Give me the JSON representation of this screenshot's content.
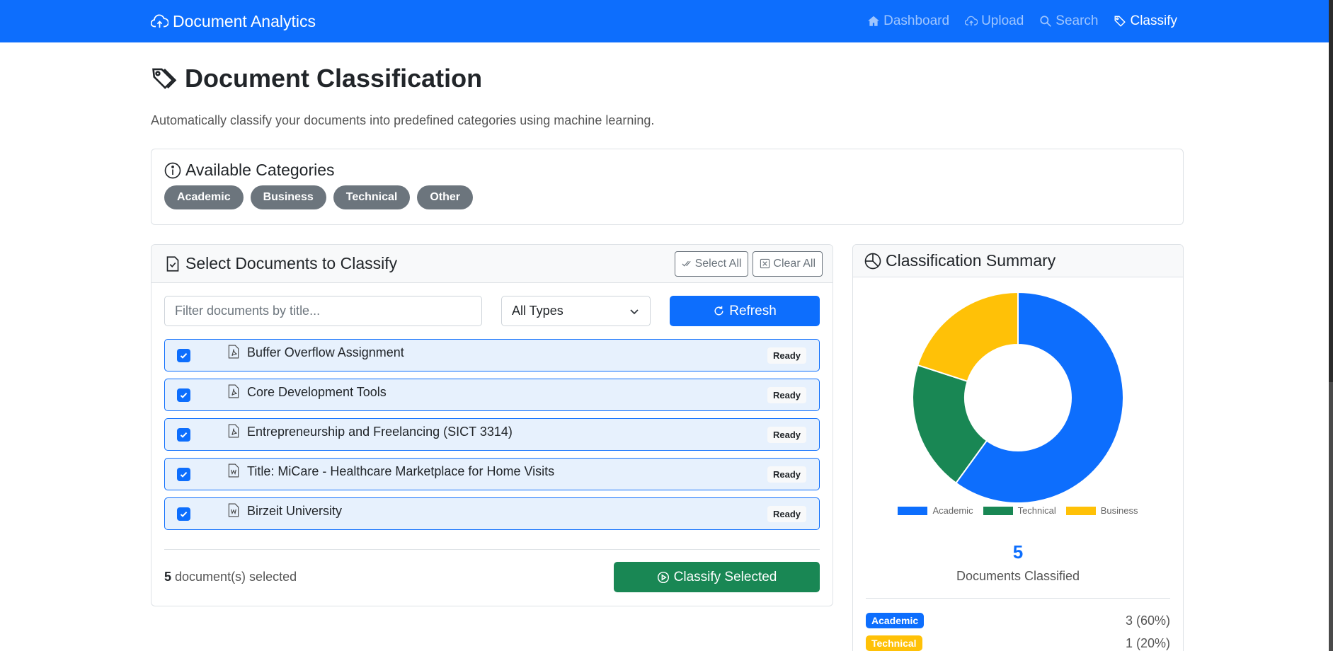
{
  "nav": {
    "brand": "Document Analytics",
    "links": [
      {
        "label": "Dashboard",
        "icon": "house-icon"
      },
      {
        "label": "Upload",
        "icon": "cloud-upload-icon"
      },
      {
        "label": "Search",
        "icon": "search-icon"
      },
      {
        "label": "Classify",
        "icon": "tags-icon",
        "active": true
      }
    ]
  },
  "page": {
    "title": "Document Classification",
    "lead": "Automatically classify your documents into predefined categories using machine learning."
  },
  "categories": {
    "title": "Available Categories",
    "items": [
      "Academic",
      "Business",
      "Technical",
      "Other"
    ]
  },
  "docs": {
    "title": "Select Documents to Classify",
    "select_all": "Select All",
    "clear_all": "Clear All",
    "filter_placeholder": "Filter documents by title...",
    "type_select": "All Types",
    "refresh": "Refresh",
    "items": [
      {
        "title": "Buffer Overflow Assignment",
        "type": "pdf",
        "status": "Ready",
        "checked": true
      },
      {
        "title": "Core Development Tools",
        "type": "pdf",
        "status": "Ready",
        "checked": true
      },
      {
        "title": "Entrepreneurship and Freelancing (SICT 3314)",
        "type": "pdf",
        "status": "Ready",
        "checked": true
      },
      {
        "title": "Title: MiCare - Healthcare Marketplace for Home Visits",
        "type": "word",
        "status": "Ready",
        "checked": true
      },
      {
        "title": "Birzeit University",
        "type": "word",
        "status": "Ready",
        "checked": true
      }
    ],
    "selected_count": "5",
    "selected_suffix": " document(s) selected",
    "classify": "Classify Selected"
  },
  "summary": {
    "title": "Classification Summary",
    "total": "5",
    "total_label": "Documents Classified",
    "rows": [
      {
        "label": "Academic",
        "value": "3 (60%)",
        "color": "#0d6efd"
      },
      {
        "label": "Technical",
        "value": "1 (20%)",
        "color": "#ffc107"
      }
    ]
  },
  "chart_data": {
    "type": "pie",
    "categories": [
      "Academic",
      "Technical",
      "Business"
    ],
    "values": [
      3,
      1,
      1
    ],
    "colors": [
      "#0d6efd",
      "#198754",
      "#ffc107"
    ],
    "legend": "bottom"
  }
}
